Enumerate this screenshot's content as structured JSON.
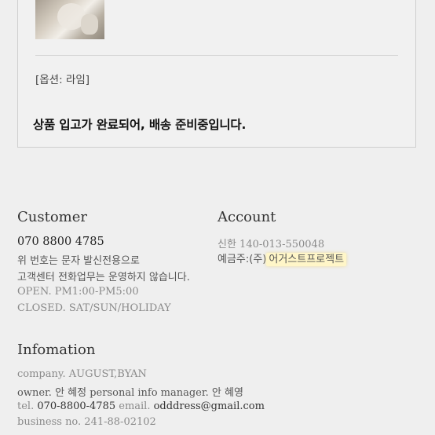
{
  "order": {
    "option_label": "[옵션: 라임]",
    "status_message": "상품 입고가 완료되어, 배송 준비중입니다."
  },
  "customer": {
    "heading": "Customer",
    "phone": "070 8800 4785",
    "note1": "위 번호는 문자 발신전용으로",
    "note2": "고객센터 전화업무는 운영하지 않습니다.",
    "hours": "OPEN. PM1:00-PM5:00",
    "closed": "CLOSED. SAT/SUN/HOLIDAY"
  },
  "account": {
    "heading": "Account",
    "bank": "신한 140-013-550048",
    "holder_prefix": "예금주:(주)",
    "holder_name": "어거스트프로젝트"
  },
  "info": {
    "heading": "Infomation",
    "company": "company. AUGUST,BYAN",
    "owner": "owner. 안 혜정 personal info manager. 안 혜영",
    "tel_label": "tel. ",
    "tel": "070-8800-4785",
    "email_label": " email. ",
    "email": "odddress@gmail.com",
    "business": "business no. 241-88-02102"
  }
}
